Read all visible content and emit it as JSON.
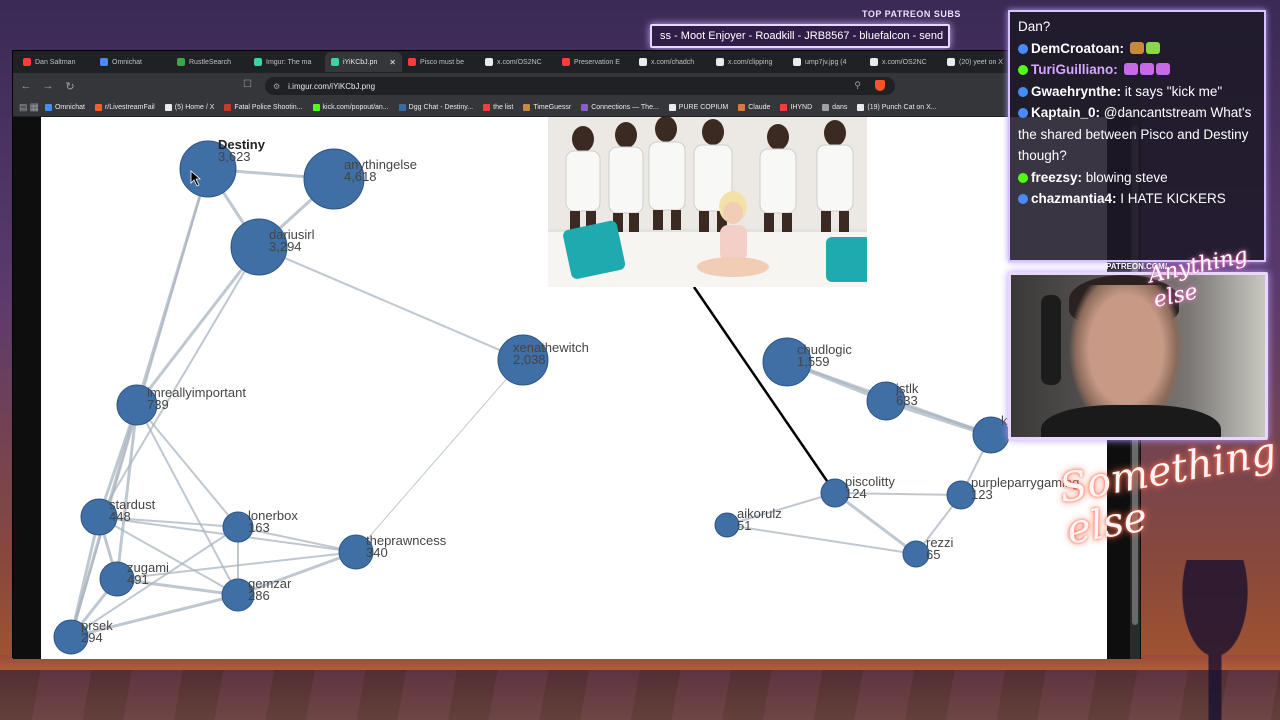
{
  "ticker": {
    "title": "TOP PATREON SUBS",
    "text": "ss - Moot Enjoyer - Roadkill - JRB8567 - bluefalcon - send"
  },
  "browser": {
    "tabs": [
      {
        "label": "Dan Saltman",
        "color": "#ff3b3b"
      },
      {
        "label": "Omnichat",
        "color": "#4a8aff"
      },
      {
        "label": "RustleSearch",
        "color": "#3aa84a"
      },
      {
        "label": "Imgur: The ma",
        "color": "#3ad4a0"
      },
      {
        "label": "iYiKCbJ.pn",
        "color": "#3ad4a0",
        "active": true
      },
      {
        "label": "Pisco must be",
        "color": "#ff3b3b"
      },
      {
        "label": "x.com/OS2NC",
        "color": "#e8eaed"
      },
      {
        "label": "Preservation E",
        "color": "#ff3b3b"
      },
      {
        "label": "x.com/chadch",
        "color": "#e8eaed"
      },
      {
        "label": "x.com/clipping",
        "color": "#e8eaed"
      },
      {
        "label": "ump7jv.jpg (4",
        "color": "#e8eaed"
      },
      {
        "label": "x.com/OS2NC",
        "color": "#e8eaed"
      },
      {
        "label": "(20) yeet on X",
        "color": "#e8eaed"
      }
    ],
    "url": "i.imgur.com/iYiKCbJ.png",
    "bookmarks": [
      {
        "label": "Omnichat",
        "color": "#4a8aff"
      },
      {
        "label": "r/LivestreamFail",
        "color": "#ff5a2a"
      },
      {
        "label": "(5) Home / X",
        "color": "#e8eaed"
      },
      {
        "label": "Fatal Police Shootin...",
        "color": "#c8392a"
      },
      {
        "label": "kick.com/popout/an...",
        "color": "#53fc18"
      },
      {
        "label": "Dgg Chat - Destiny...",
        "color": "#3a6aa8"
      },
      {
        "label": "the list",
        "color": "#ff3b3b"
      },
      {
        "label": "TimeGuessr",
        "color": "#c88a3a"
      },
      {
        "label": "Connections — The...",
        "color": "#8a5ad8"
      },
      {
        "label": "PURE COPIUM",
        "color": "#e8eaed"
      },
      {
        "label": "Claude",
        "color": "#d8783a"
      },
      {
        "label": "IHYND",
        "color": "#ff3b3b"
      },
      {
        "label": "dans",
        "color": "#9aa0a6"
      },
      {
        "label": "(19) Punch Cat on X...",
        "color": "#e8eaed"
      }
    ]
  },
  "graph": {
    "nodes": [
      {
        "name": "Destiny",
        "count": "3,623",
        "bold": true
      },
      {
        "name": "anythingelse",
        "count": "4,618"
      },
      {
        "name": "dariusirl",
        "count": "3,294"
      },
      {
        "name": "xenathewitch",
        "count": "2,038"
      },
      {
        "name": "imreallyimportant",
        "count": "739"
      },
      {
        "name": "stardust",
        "count": "448"
      },
      {
        "name": "lonerbox",
        "count": "163"
      },
      {
        "name": "theprawncess",
        "count": "340"
      },
      {
        "name": "zugami",
        "count": "491"
      },
      {
        "name": "gemzar",
        "count": "286"
      },
      {
        "name": "prsek",
        "count": "294"
      },
      {
        "name": "chudlogic",
        "count": "1,559"
      },
      {
        "name": "jstlk",
        "count": "633"
      },
      {
        "name": "piscolitty",
        "count": "124"
      },
      {
        "name": "purpleparrygaming",
        "count": "123"
      },
      {
        "name": "aikorulz",
        "count": "51"
      },
      {
        "name": "rezzi",
        "count": "65"
      },
      {
        "name": "k",
        "count": ""
      }
    ]
  },
  "chat": {
    "messages": [
      {
        "user": "",
        "text": "Dan?",
        "badge": ""
      },
      {
        "user": "DemCroatoan:",
        "text": "",
        "badge": "#4a8aff",
        "userColor": "#ffffff"
      },
      {
        "user": "TuriGuilliano:",
        "text": "",
        "badge": "#53fc18",
        "userColor": "#d8a8ff"
      },
      {
        "user": "Gwaehrynthe:",
        "text": "it says \"kick me\"",
        "badge": "#4a8aff",
        "userColor": "#ffffff"
      },
      {
        "user": "Kaptain_0:",
        "text": "@dancantstream What's the shared between Pisco and Destiny though?",
        "badge": "#4a8aff",
        "userColor": "#ffffff"
      },
      {
        "user": "freezsy:",
        "text": "blowing steve",
        "badge": "#53fc18",
        "userColor": "#ffffff"
      },
      {
        "user": "chazmantia4:",
        "text": "I HATE KICKERS",
        "badge": "#4a8aff",
        "userColor": "#ffffff"
      }
    ]
  },
  "overlay": {
    "patreon": "PATREON.COM/",
    "signature_top": "Anything else",
    "signature": "Something else"
  }
}
